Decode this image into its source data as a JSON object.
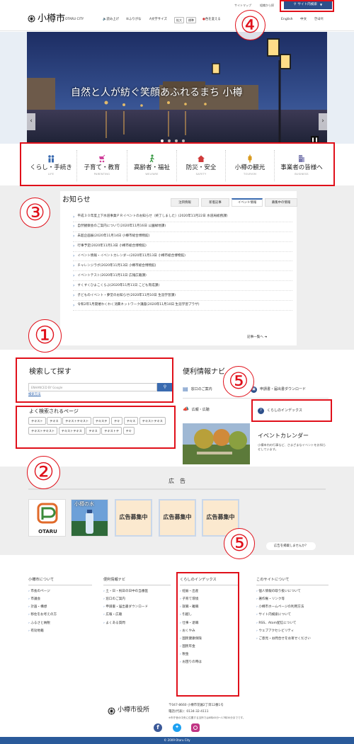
{
  "header": {
    "logo_text": "小樽市",
    "logo_sub": "OTARU CITY",
    "top_links": [
      "サイトマップ",
      "組織から探"
    ],
    "site_search_label": "サイト内検索",
    "read_aloud": "読み上げ",
    "furigana": "ふりがな",
    "font_size_label": "文字サイズ",
    "font_large": "拡大",
    "font_standard": "標準",
    "color_label": "色を変える",
    "color_option": "青",
    "lang_english": "English",
    "lang_chinese": "中文",
    "lang_korean": "한국어"
  },
  "hero": {
    "tagline": "自然と人が紡ぐ笑顔あふれるまち 小樽"
  },
  "categories": [
    {
      "label": "くらし・手続き",
      "en": "LIFE",
      "icon": "people-icon",
      "color": "#3a6bb0"
    },
    {
      "label": "子育て・教育",
      "en": "PARENTING",
      "icon": "stroller-icon",
      "color": "#d0409a"
    },
    {
      "label": "高齢者・福祉",
      "en": "WELFARE",
      "icon": "walking-icon",
      "color": "#3a9a45"
    },
    {
      "label": "防災・安全",
      "en": "SAFETY",
      "icon": "house-icon",
      "color": "#d03a3a"
    },
    {
      "label": "小樽の観光",
      "en": "TOURISM",
      "icon": "lantern-icon",
      "color": "#d99a1e"
    },
    {
      "label": "事業者の皆様へ",
      "en": "BUSINESS",
      "icon": "building-icon",
      "color": "#7d7db0"
    }
  ],
  "news": {
    "heading": "お知らせ",
    "tabs": [
      "注目情報",
      "新着記事",
      "イベント情報",
      "募集中の情報"
    ],
    "active_tab": "イベント情報",
    "items": [
      "平成３０年度上下水道事業ＰＲイベントのお知らせ（終了しました）(2020年11月22日 水道局総務課)",
      "自然観察会のご案内について(2020年11月16日 公園緑地課)",
      "未超企画展(2020年11月14日 小樽市総合博物館)",
      "行事予定(2020年11月13日 小樽市総合博物館)",
      "イベント情報・イベントカレンダー(2020年11月13日 小樽市総合博物館)",
      "チャレンジラボ(2020年11月13日 小樽市総合博物館)",
      "イベントテスト(2020年11月11日 広報広聴課)",
      "すくすくひよこくらぶ(2020年11月11日 こども育成課)",
      "子どものイベント・夢堂のお知らせ(2020年11月10日 生涯学習課)",
      "令和2年1月開催わくわく消費ネットワーク講座(2020年11月10日 生涯学習プラザ)"
    ],
    "more_button": "記事一覧へ"
  },
  "search": {
    "heading": "検索して探す",
    "input_placeholder": "ENHANCED BY Google",
    "help_link": "検索方法",
    "popular_heading": "よく検索されるページ",
    "popular_tags": [
      "テキスト",
      "テキス",
      "テキストテキスト",
      "テキステ",
      "テキ",
      "テキス",
      "テキストテキス",
      "テキストテキスト",
      "テキストテキス",
      "テキス",
      "テキストテ",
      "テキ"
    ]
  },
  "convenience": {
    "heading": "便利情報ナビ",
    "items": [
      "窓口のご案内",
      "申請書・届出書ダウンロード",
      "広報・広聴",
      "くらしのインデックス"
    ],
    "event_calendar_title": "イベントカレンダー",
    "event_calendar_desc": "小樽市内の行事など、さまざまなイベントをお知らせしています。"
  },
  "ads": {
    "heading": "広　告",
    "otaru_logo_text": "OTARU",
    "water_label": "小樽の水",
    "slots": [
      "広告募集中",
      "広告募集中",
      "広告募集中"
    ],
    "post_ad_button": "広告を掲載しませんか？"
  },
  "footer": {
    "col1_title": "小樽市について",
    "col1_links": [
      "市長のページ",
      "市議会",
      "計画・構想",
      "移住をお考えの方",
      "ふるさと納税",
      "有効地籍"
    ],
    "col2_title": "便利情報ナビ",
    "col2_links": [
      "土・日・祝日の日中の当番医",
      "窓口のご案内",
      "申請書・届出書ダウンロード",
      "広報・広聴",
      "よくある質問"
    ],
    "col3_title": "くらしのインデックス",
    "col3_links": [
      "妊娠・出産",
      "子育て環境",
      "就職・離職",
      "引越し",
      "仕事・退職",
      "おくやみ",
      "国民健康保険",
      "国民年金",
      "税金",
      "お困りの時は"
    ],
    "col4_title": "このサイトについて",
    "col4_links": [
      "個人情報の取り扱いについて",
      "著作権・リンク等",
      "小樽市ホームページの利用方法",
      "サイト内検索について",
      "RSS、Atom配信について",
      "ウェブアクセシビリティ",
      "ご意見・お問合せをお寄せください"
    ],
    "office_name": "小樽市役所",
    "address": "〒047-8660 小樽市花園2丁目12番1号",
    "phone": "電話(代表)：0134-32-4111",
    "note": "※市庁舎の中央に位置する当所では8時45分〜17時30分までです。",
    "copyright": "© 2009 Otaru City"
  },
  "annotations": [
    "①",
    "②",
    "③",
    "④",
    "⑤",
    "⑤"
  ],
  "colors": {
    "accent": "#3a6bb0",
    "annotation": "#e0101a",
    "footer_bar": "#2a5a9a"
  }
}
